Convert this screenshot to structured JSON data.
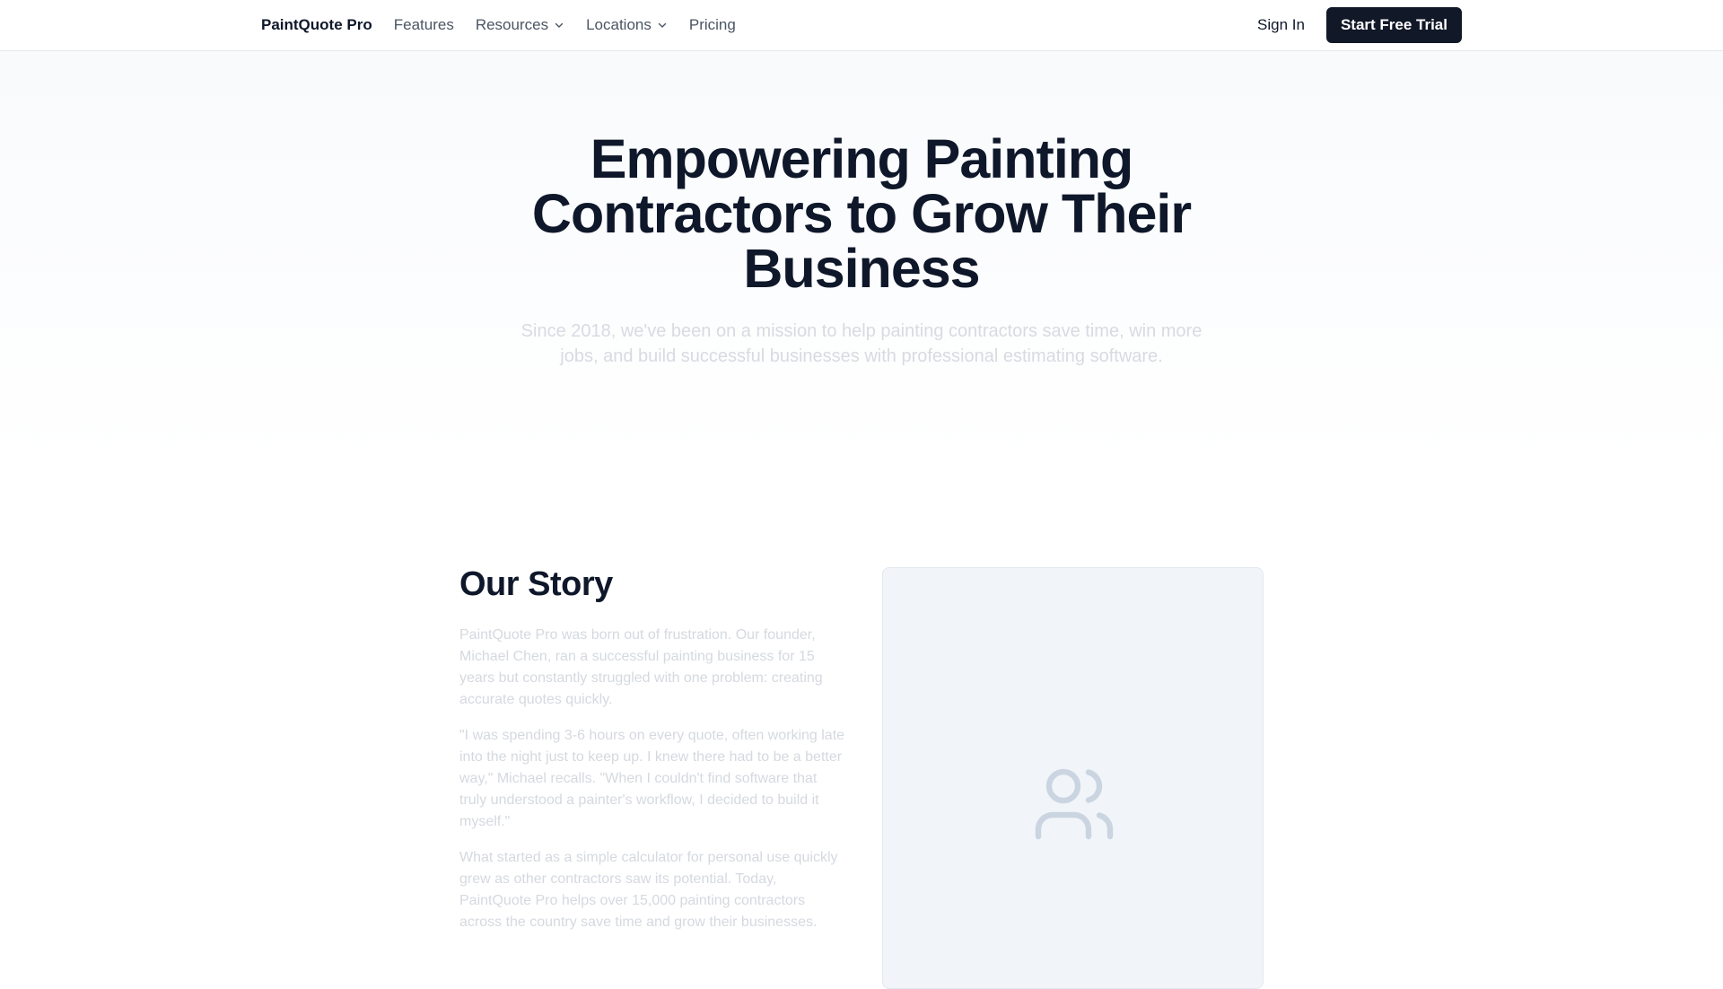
{
  "nav": {
    "brand": "PaintQuote Pro",
    "links": [
      {
        "label": "Features",
        "has_dropdown": false
      },
      {
        "label": "Resources",
        "has_dropdown": true
      },
      {
        "label": "Locations",
        "has_dropdown": true
      },
      {
        "label": "Pricing",
        "has_dropdown": false
      }
    ],
    "sign_in": "Sign In",
    "cta": "Start Free Trial"
  },
  "hero": {
    "title": "Empowering Painting Contractors to Grow Their Business",
    "subtitle": "Since 2018, we've been on a mission to help painting contractors save time, win more jobs, and build successful businesses with professional estimating software."
  },
  "story": {
    "title": "Our Story",
    "paragraphs": [
      "PaintQuote Pro was born out of frustration. Our founder, Michael Chen, ran a successful painting business for 15 years but constantly struggled with one problem: creating accurate quotes quickly.",
      "\"I was spending 3-6 hours on every quote, often working late into the night just to keep up. I knew there had to be a better way,\" Michael recalls. \"When I couldn't find software that truly understood a painter's workflow, I decided to build it myself.\"",
      "What started as a simple calculator for personal use quickly grew as other contractors saw its potential. Today, PaintQuote Pro helps over 15,000 painting contractors across the country save time and grow their businesses."
    ],
    "image_icon": "users-icon"
  },
  "colors": {
    "primary_dark": "#111827",
    "heading": "#0f172a",
    "nav_text": "#4b5563",
    "muted_text": "#d5d9df",
    "placeholder_bg": "#f1f5f9",
    "placeholder_icon": "#cbd5e1"
  }
}
